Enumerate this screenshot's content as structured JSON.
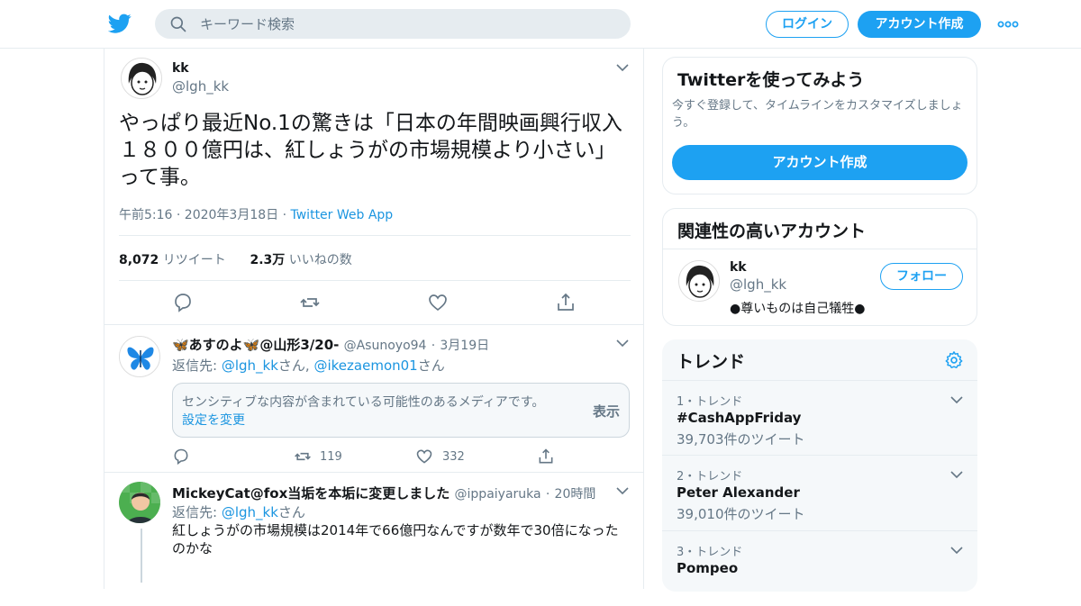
{
  "header": {
    "search_placeholder": "キーワード検索",
    "login_label": "ログイン",
    "signup_label": "アカウント作成"
  },
  "main_tweet": {
    "display_name": "kk",
    "handle": "@lgh_kk",
    "text": "やっぱり最近No.1の驚きは「日本の年間映画興行収入１８００億円は、紅しょうがの市場規模より小さい」って事。",
    "time": "午前5:16 · 2020年3月18日",
    "app": "Twitter Web App",
    "retweets": "8,072",
    "retweets_label": "リツイート",
    "likes": "2.3万",
    "likes_label": "いいねの数"
  },
  "replies": [
    {
      "display_name": "🦋あすのよ🦋@山形3/20-",
      "handle": "@Asunoyo94",
      "date": "3月19日",
      "replying_label": "返信先:",
      "replying_to": [
        "@lgh_kk",
        "@ikezaemon01"
      ],
      "replying_suffix_1": "さん,",
      "replying_suffix_2": "さん",
      "sensitive_text": "センシティブな内容が含まれている可能性のあるメディアです。",
      "sensitive_link": "設定を変更",
      "sensitive_show": "表示",
      "retweets": "119",
      "likes": "332"
    },
    {
      "display_name": "MickeyCat@fox当垢を本垢に変更しました",
      "handle": "@ippaiyaruka",
      "date": "20時間",
      "replying_label": "返信先:",
      "replying_to": [
        "@lgh_kk"
      ],
      "replying_suffix_1": "さん",
      "text": "紅しょうがの市場規模は2014年で66億円なんですが数年で30倍になったのかな"
    }
  ],
  "sidebar": {
    "signup_card": {
      "title": "Twitterを使ってみよう",
      "description": "今すぐ登録して、タイムラインをカスタマイズしましょう。",
      "button": "アカウント作成"
    },
    "related": {
      "title": "関連性の高いアカウント",
      "account": {
        "display_name": "kk",
        "handle": "@lgh_kk",
        "bio": "●尊いものは自己犠牲●",
        "follow_label": "フォロー"
      }
    },
    "trends": {
      "title": "トレンド",
      "items": [
        {
          "meta": "1・トレンド",
          "name": "#CashAppFriday",
          "count": "39,703件のツイート"
        },
        {
          "meta": "2・トレンド",
          "name": "Peter Alexander",
          "count": "39,010件のツイート"
        },
        {
          "meta": "3・トレンド",
          "name": "Pompeo",
          "count": ""
        }
      ]
    }
  },
  "colors": {
    "brand": "#1da1f2",
    "link": "#1b95e0",
    "muted": "#657786",
    "border": "#e6ecf0"
  }
}
